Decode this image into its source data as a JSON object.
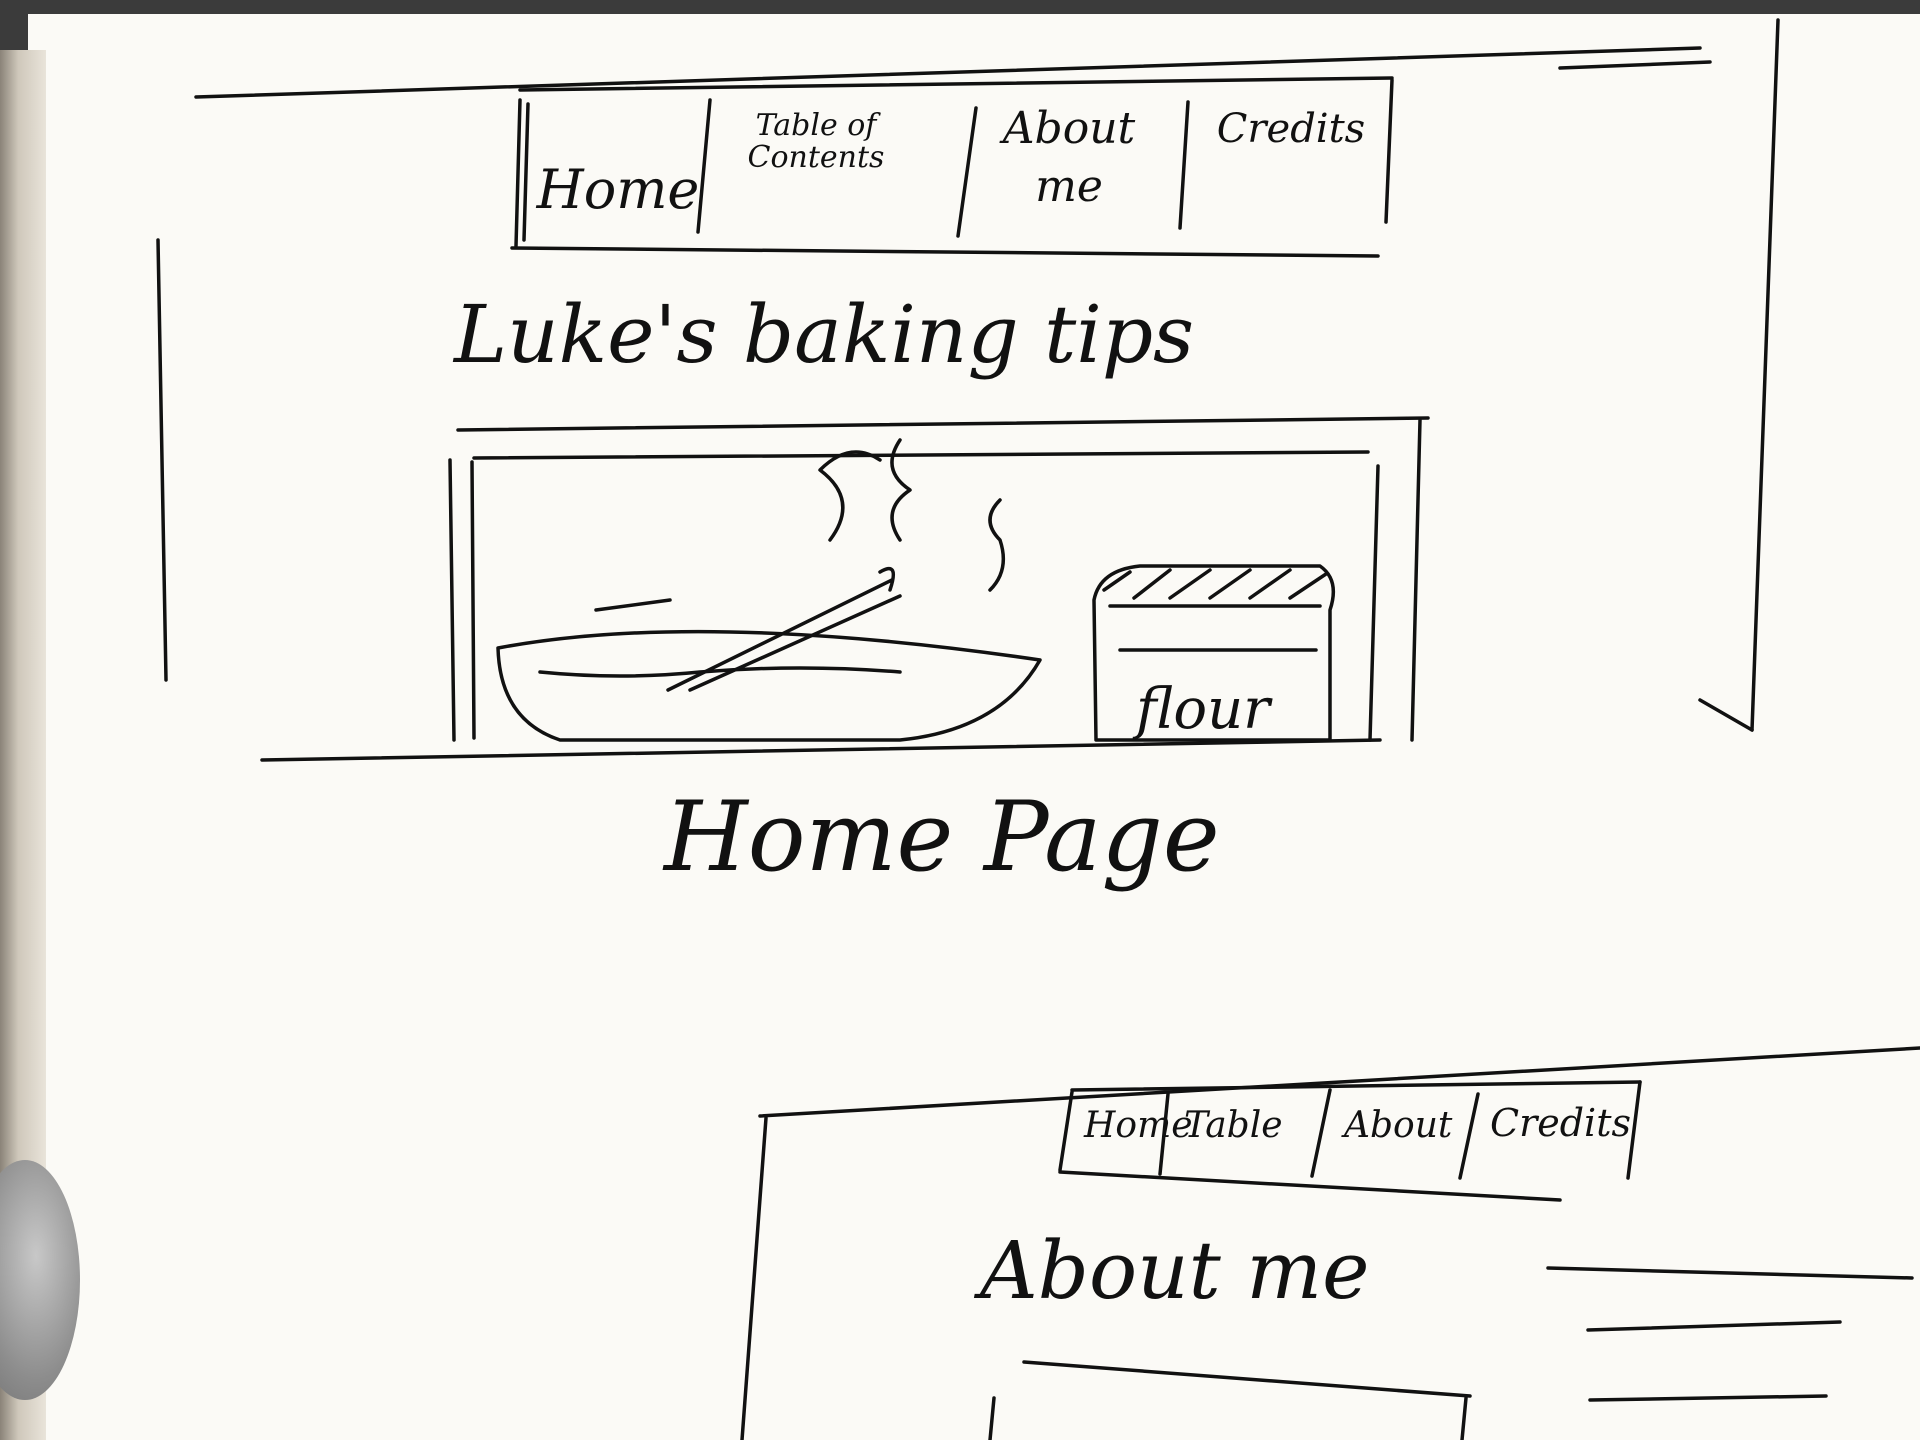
{
  "sketch_1": {
    "nav": [
      {
        "label": "Home"
      },
      {
        "label": "Table of Contents"
      },
      {
        "label": "About me"
      },
      {
        "label": "Credits"
      }
    ],
    "site_title": "Luke's baking tips",
    "image_label": "flour",
    "caption": "Home Page"
  },
  "sketch_2": {
    "nav": [
      {
        "label": "Home"
      },
      {
        "label": "Table"
      },
      {
        "label": "About"
      },
      {
        "label": "Credits"
      }
    ],
    "page_title": "About me"
  },
  "colors": {
    "ink": "#111111",
    "paper": "#fbfaf6",
    "background": "#3b3b3b"
  }
}
